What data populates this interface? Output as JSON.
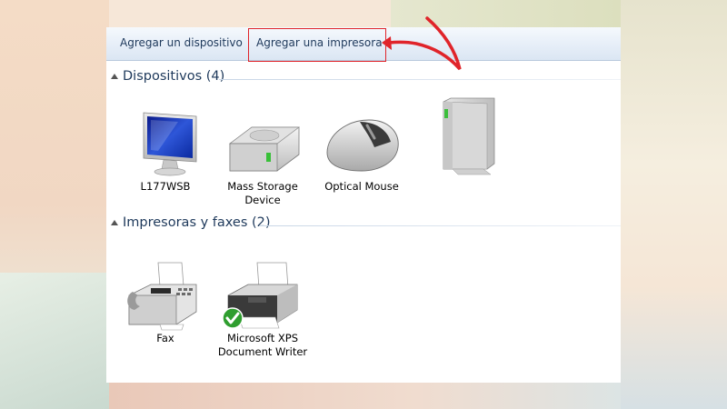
{
  "toolbar": {
    "add_device": "Agregar un dispositivo",
    "add_printer": "Agregar una impresora"
  },
  "groups": [
    {
      "title": "Dispositivos (4)",
      "items": [
        {
          "label": "L177WSB",
          "icon": "monitor-icon"
        },
        {
          "label": "Mass Storage\nDevice",
          "icon": "hard-drive-icon"
        },
        {
          "label": "Optical Mouse",
          "icon": "mouse-icon"
        },
        {
          "label": "",
          "icon": "computer-tower-icon"
        }
      ]
    },
    {
      "title": "Impresoras y faxes (2)",
      "items": [
        {
          "label": "Fax",
          "icon": "fax-icon"
        },
        {
          "label": "Microsoft XPS\nDocument Writer",
          "icon": "printer-icon",
          "default": true
        }
      ]
    }
  ],
  "colors": {
    "accent_text": "#1e395b",
    "highlight": "#e0242a"
  }
}
